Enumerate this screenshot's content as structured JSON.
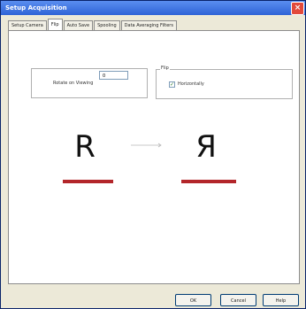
{
  "window": {
    "title": "Setup Acquisition",
    "close_glyph": "×"
  },
  "tabs": [
    {
      "label": "Setup Camera",
      "active": false
    },
    {
      "label": "Flip",
      "active": true
    },
    {
      "label": "Auto Save",
      "active": false
    },
    {
      "label": "Spooling",
      "active": false
    },
    {
      "label": "Data Averaging Filters",
      "active": false
    }
  ],
  "rotate": {
    "label": "Rotate on Viewing",
    "value": "0"
  },
  "flip": {
    "legend": "Flip",
    "horizontally_label": "Horizontally",
    "horizontally_checked": true,
    "check_glyph": "✓"
  },
  "preview": {
    "original_letter": "R",
    "flipped_letter": "Я",
    "underline_color": "#b3262a"
  },
  "buttons": {
    "ok": "OK",
    "cancel": "Cancel",
    "help": "Help"
  }
}
